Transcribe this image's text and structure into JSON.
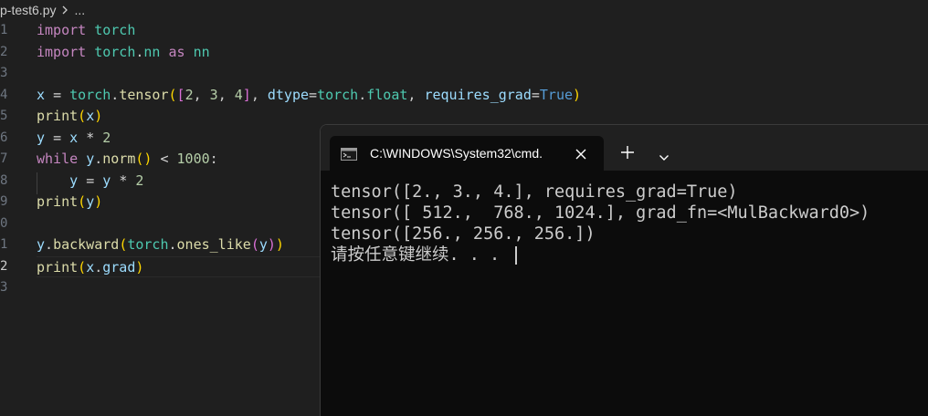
{
  "editor": {
    "breadcrumb": {
      "file": "p-test6.py",
      "ellipsis": "..."
    },
    "line_numbers": [
      "1",
      "2",
      "3",
      "4",
      "5",
      "6",
      "7",
      "8",
      "9",
      "0",
      "1",
      "2",
      "3"
    ],
    "active_line": 12
  },
  "terminal": {
    "tab_title": "C:\\WINDOWS\\System32\\cmd.",
    "output_lines": [
      "tensor([2., 3., 4.], requires_grad=True)",
      "tensor([ 512.,  768., 1024.], grad_fn=<MulBackward0>)",
      "tensor([256., 256., 256.])",
      "请按任意键继续. . . "
    ]
  },
  "colors": {
    "keyword": "#c586c0",
    "module": "#4ec9b0",
    "variable": "#9cdcfe",
    "function": "#dcdcaa",
    "number": "#b5cea8",
    "constant": "#569cd6",
    "editor_bg": "#1f1f1f",
    "terminal_bg": "#0c0c0c"
  }
}
